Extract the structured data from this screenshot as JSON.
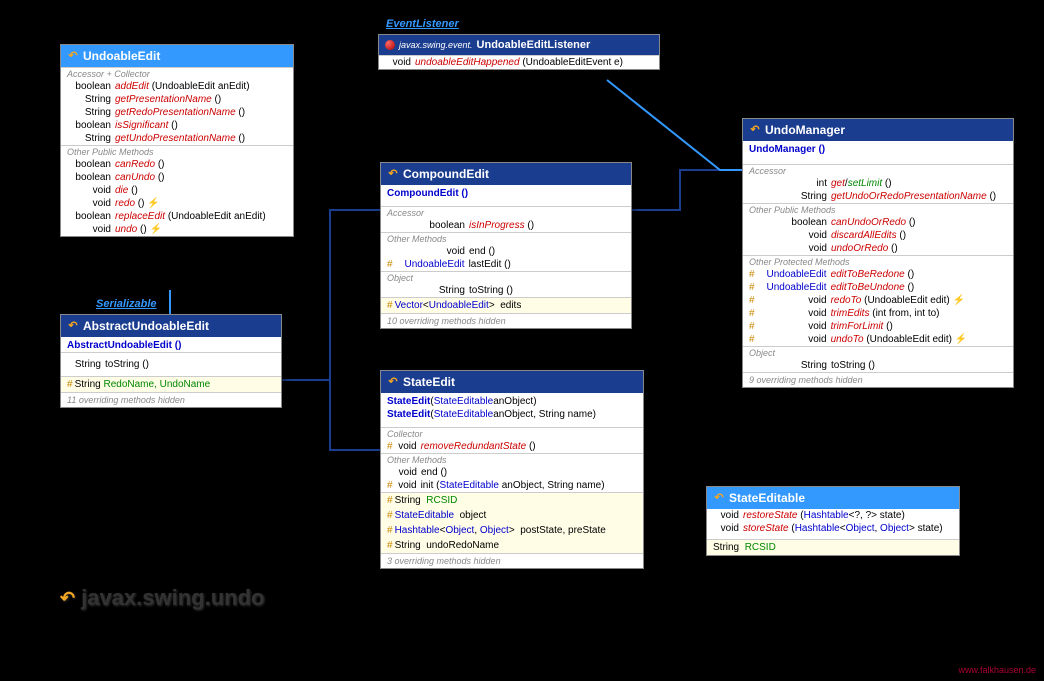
{
  "package": "javax.swing.undo",
  "credit": "www.falkhausen.de",
  "stereotypes": {
    "serializable": "Serializable",
    "eventListener": "EventListener"
  },
  "undoableEdit": {
    "title": "UndoableEdit",
    "sections": {
      "s1": "Accessor + Collector",
      "s2": "Other Public Methods"
    },
    "m": {
      "addEdit": {
        "ret": "boolean",
        "name": "addEdit",
        "args": "(UndoableEdit anEdit)"
      },
      "getPresentationName": {
        "ret": "String",
        "name": "getPresentationName",
        "args": "()"
      },
      "getRedoPresentationName": {
        "ret": "String",
        "name": "getRedoPresentationName",
        "args": "()"
      },
      "isSignificant": {
        "ret": "boolean",
        "name": "isSignificant",
        "args": "()"
      },
      "getUndoPresentationName": {
        "ret": "String",
        "name": "getUndoPresentationName",
        "args": "()"
      },
      "canRedo": {
        "ret": "boolean",
        "name": "canRedo",
        "args": "()"
      },
      "canUndo": {
        "ret": "boolean",
        "name": "canUndo",
        "args": "()"
      },
      "die": {
        "ret": "void",
        "name": "die",
        "args": "()"
      },
      "redo": {
        "ret": "void",
        "name": "redo",
        "args": "() ⚡"
      },
      "replaceEdit": {
        "ret": "boolean",
        "name": "replaceEdit",
        "args": "(UndoableEdit anEdit)"
      },
      "undo": {
        "ret": "void",
        "name": "undo",
        "args": "() ⚡"
      }
    }
  },
  "listener": {
    "pkg": "javax.swing.event.",
    "title": "UndoableEditListener",
    "m": {
      "ret": "void",
      "name": "undoableEditHappened",
      "args": "(UndoableEditEvent e)"
    }
  },
  "abstractUE": {
    "title": "AbstractUndoableEdit",
    "ctor": "AbstractUndoableEdit ()",
    "toString": {
      "ret": "String",
      "name": "toString ()"
    },
    "fields": "String  RedoName, UndoName",
    "hidden": "11 overriding methods hidden"
  },
  "compoundEdit": {
    "title": "CompoundEdit",
    "ctor": "CompoundEdit ()",
    "sections": {
      "acc": "Accessor",
      "other": "Other Methods",
      "obj": "Object"
    },
    "m": {
      "isInProgress": {
        "ret": "boolean",
        "name": "isInProgress",
        "args": "()"
      },
      "end": {
        "ret": "void",
        "name": "end",
        "args": "()"
      },
      "lastEdit": {
        "ret": "UndoableEdit",
        "name": "lastEdit",
        "args": "()"
      },
      "toString": {
        "ret": "String",
        "name": "toString",
        "args": "()"
      }
    },
    "fields": "Vector<UndoableEdit>  edits",
    "hidden": "10 overriding methods hidden"
  },
  "stateEdit": {
    "title": "StateEdit",
    "ctor1": "StateEdit (StateEditable anObject)",
    "ctor2": "StateEdit (StateEditable anObject, String name)",
    "sections": {
      "coll": "Collector",
      "other": "Other Methods"
    },
    "m": {
      "removeRedundantState": {
        "ret": "void",
        "name": "removeRedundantState",
        "args": "()"
      },
      "end": {
        "ret": "void",
        "name": "end",
        "args": "()"
      },
      "init": {
        "ret": "void",
        "name": "init",
        "args": "(StateEditable anObject, String name)"
      }
    },
    "fields": {
      "rcsid": "String  RCSID",
      "object": "StateEditable  object",
      "hashtable": "Hashtable<Object, Object>  postState, preState",
      "undoRedoName": "String  undoRedoName"
    },
    "hidden": "3 overriding methods hidden"
  },
  "undoManager": {
    "title": "UndoManager",
    "ctor": "UndoManager ()",
    "sections": {
      "acc": "Accessor",
      "opub": "Other Public Methods",
      "oprot": "Other Protected Methods",
      "obj": "Object"
    },
    "m": {
      "limit": {
        "ret": "int",
        "name": "get/setLimit",
        "args": "()"
      },
      "getUndoOrRedoPresentationName": {
        "ret": "String",
        "name": "getUndoOrRedoPresentationName",
        "args": "()"
      },
      "canUndoOrRedo": {
        "ret": "boolean",
        "name": "canUndoOrRedo",
        "args": "()"
      },
      "discardAllEdits": {
        "ret": "void",
        "name": "discardAllEdits",
        "args": "()"
      },
      "undoOrRedo": {
        "ret": "void",
        "name": "undoOrRedo",
        "args": "()"
      },
      "editToBeRedone": {
        "ret": "UndoableEdit",
        "name": "editToBeRedone",
        "args": "()"
      },
      "editToBeUndone": {
        "ret": "UndoableEdit",
        "name": "editToBeUndone",
        "args": "()"
      },
      "redoTo": {
        "ret": "void",
        "name": "redoTo",
        "args": "(UndoableEdit edit) ⚡"
      },
      "trimEdits": {
        "ret": "void",
        "name": "trimEdits",
        "args": "(int from, int to)"
      },
      "trimForLimit": {
        "ret": "void",
        "name": "trimForLimit",
        "args": "()"
      },
      "undoTo": {
        "ret": "void",
        "name": "undoTo",
        "args": "(UndoableEdit edit) ⚡"
      },
      "toString": {
        "ret": "String",
        "name": "toString",
        "args": "()"
      }
    },
    "hidden": "9 overriding methods hidden"
  },
  "stateEditable": {
    "title": "StateEditable",
    "m": {
      "restoreState": {
        "ret": "void",
        "name": "restoreState",
        "args": "(Hashtable<?, ?> state)"
      },
      "storeState": {
        "ret": "void",
        "name": "storeState",
        "args": "(Hashtable<Object, Object> state)"
      }
    },
    "field": "String  RCSID"
  }
}
